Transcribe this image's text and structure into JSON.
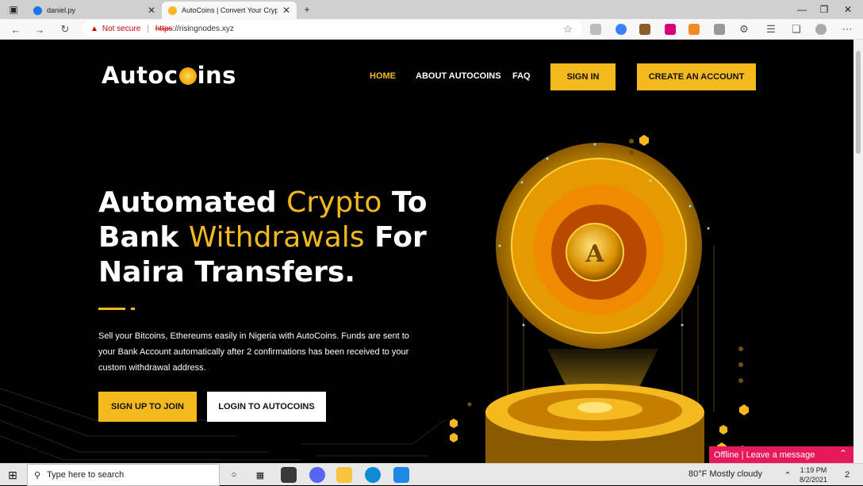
{
  "browser": {
    "tabs": [
      {
        "title": "daniel.py",
        "active": false
      },
      {
        "title": "AutoCoins | Convert Your Crypto",
        "active": true
      }
    ],
    "address": {
      "security_label": "Not secure",
      "scheme": "https",
      "host": "://risingnodes.xyz"
    }
  },
  "site": {
    "logo": {
      "before": "Autoc",
      "after": "ins"
    },
    "nav": {
      "home": "HOME",
      "about": "ABOUT AUTOCOINS",
      "faq": "FAQ",
      "signin": "SIGN IN",
      "create": "CREATE AN ACCOUNT"
    },
    "hero": {
      "line1_a": "Automated ",
      "line1_b": "Crypto",
      "line1_c": " To",
      "line2_a": "Bank ",
      "line2_b": "Withdrawals",
      "line2_c": " For",
      "line3": "Naira Transfers.",
      "description": "Sell your Bitcoins, Ethereums easily in Nigeria with AutoCoins. Funds are sent to your Bank Account automatically after 2 confirmations has been received to your custom withdrawal address.",
      "cta_primary": "SIGN UP TO JOIN",
      "cta_secondary": "LOGIN TO AUTOCOINS",
      "coin_letter": "A"
    },
    "chat": {
      "label": "Offline | Leave a message"
    }
  },
  "taskbar": {
    "search_placeholder": "Type here to search",
    "weather": "80°F  Mostly cloudy",
    "time": "1:19 PM",
    "date": "8/2/2021",
    "notifications": "2"
  },
  "colors": {
    "accent": "#f5b920",
    "background": "#000000",
    "chat": "#e8185c"
  }
}
